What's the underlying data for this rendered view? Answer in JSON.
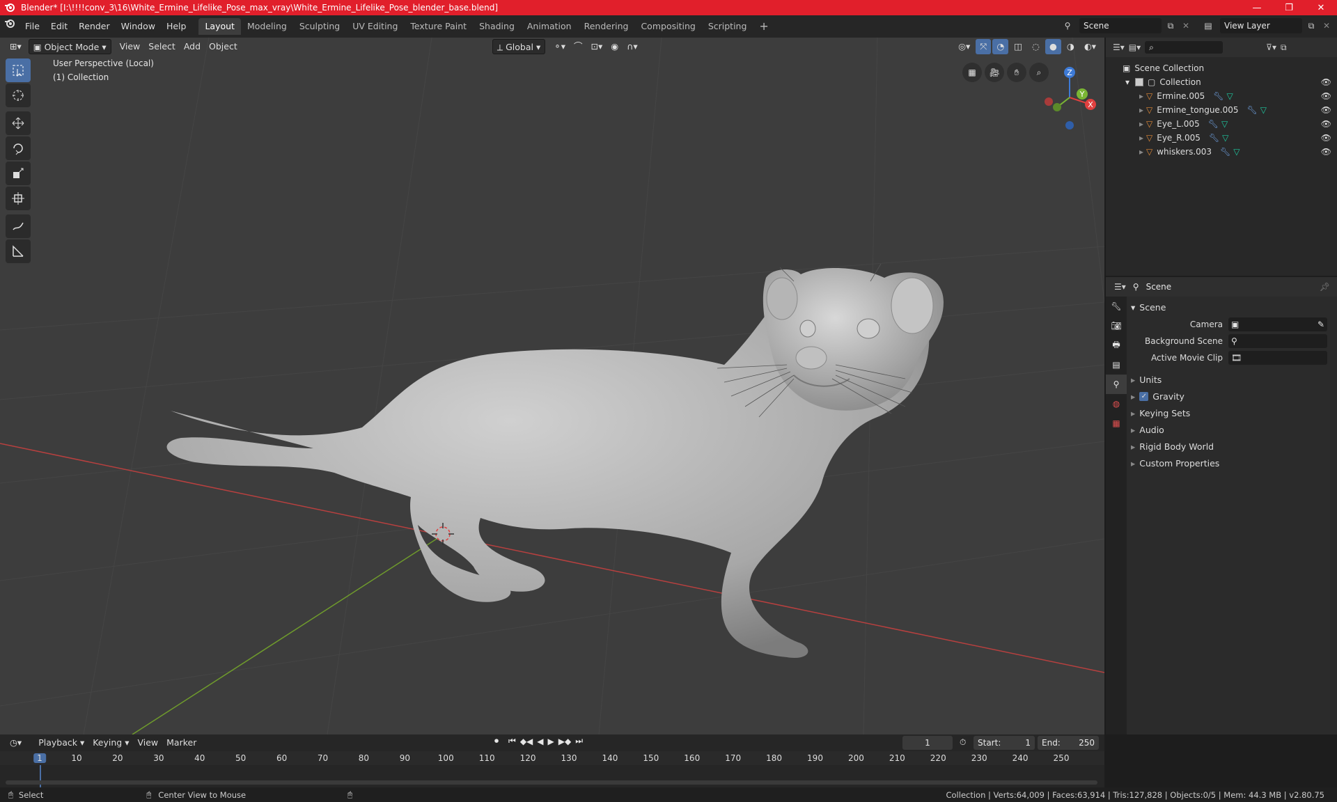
{
  "window": {
    "title": "Blender* [I:\\!!!!conv_3\\16\\White_Ermine_Lifelike_Pose_max_vray\\White_Ermine_Lifelike_Pose_blender_base.blend]",
    "minimize": "—",
    "maximize": "❐",
    "close": "✕"
  },
  "menu": {
    "items": [
      "File",
      "Edit",
      "Render",
      "Window",
      "Help"
    ]
  },
  "workspaces": [
    "Layout",
    "Modeling",
    "Sculpting",
    "UV Editing",
    "Texture Paint",
    "Shading",
    "Animation",
    "Rendering",
    "Compositing",
    "Scripting"
  ],
  "scene_field": "Scene",
  "view_layer_field": "View Layer",
  "viewport": {
    "mode": "Object Mode",
    "menus": [
      "View",
      "Select",
      "Add",
      "Object"
    ],
    "transform_orientation": "Global",
    "info_line1": "User Perspective (Local)",
    "info_line2": "(1) Collection",
    "gizmo_axes": {
      "x": "X",
      "y": "Y",
      "z": "Z"
    }
  },
  "outliner": {
    "search_placeholder": "",
    "root": "Scene Collection",
    "collection": "Collection",
    "objects": [
      "Ermine.005",
      "Ermine_tongue.005",
      "Eye_L.005",
      "Eye_R.005",
      "whiskers.003"
    ]
  },
  "properties": {
    "context": "Scene",
    "section": "Scene",
    "rows": [
      {
        "label": "Camera",
        "value": ""
      },
      {
        "label": "Background Scene",
        "value": ""
      },
      {
        "label": "Active Movie Clip",
        "value": ""
      }
    ],
    "panels": [
      "Units",
      "Gravity",
      "Keying Sets",
      "Audio",
      "Rigid Body World",
      "Custom Properties"
    ],
    "gravity_checked": true
  },
  "timeline": {
    "menus": [
      "Playback",
      "Keying",
      "View",
      "Marker"
    ],
    "current_frame": "1",
    "start_label": "Start:",
    "start": "1",
    "end_label": "End:",
    "end": "250",
    "ticks": [
      "1",
      "10",
      "20",
      "30",
      "40",
      "50",
      "60",
      "70",
      "80",
      "90",
      "100",
      "110",
      "120",
      "130",
      "140",
      "150",
      "160",
      "170",
      "180",
      "190",
      "200",
      "210",
      "220",
      "230",
      "240",
      "250"
    ]
  },
  "status": {
    "left": "Select",
    "mid": "Center View to Mouse",
    "right": "Collection | Verts:64,009 | Faces:63,914 | Tris:127,828 | Objects:0/5 | Mem: 44.3 MB | v2.80.75"
  },
  "colors": {
    "accent": "#4a6fa5",
    "titlebar": "#e11f2b",
    "x_axis": "#e0403f",
    "y_axis": "#7ab534",
    "z_axis": "#3d7ad6"
  }
}
